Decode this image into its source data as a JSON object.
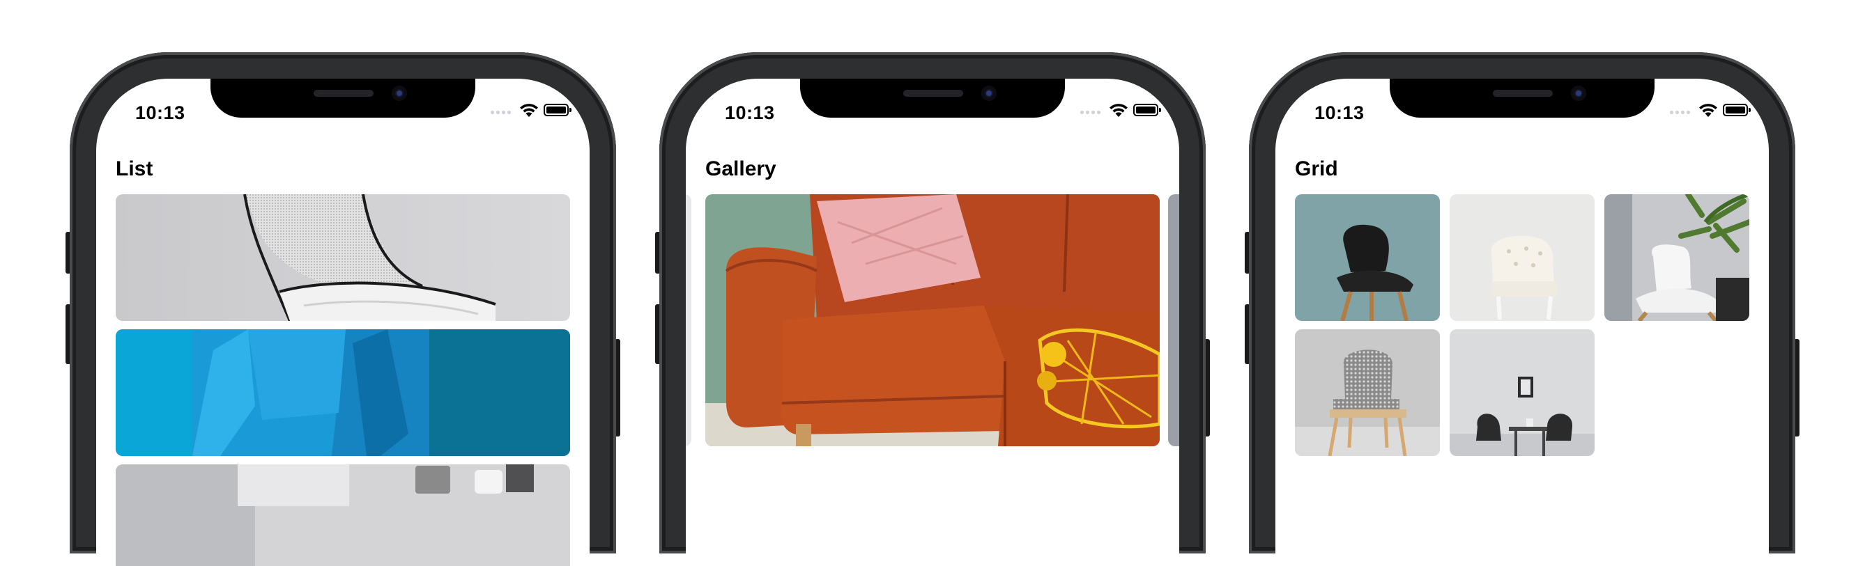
{
  "phones": [
    {
      "time": "10:13",
      "title": "List"
    },
    {
      "time": "10:13",
      "title": "Gallery"
    },
    {
      "time": "10:13",
      "title": "Grid"
    }
  ],
  "status_icons": [
    "signal-dots-icon",
    "wifi-icon",
    "battery-icon"
  ],
  "images": {
    "list": [
      "white-chair-photo",
      "blue-chair-photo",
      "chair-and-kettle-photo"
    ],
    "gallery": [
      "orange-sofa-photo"
    ],
    "grid": [
      "black-chair-photo",
      "tufted-chair-photo",
      "white-chair-plant-photo",
      "patterned-chair-photo",
      "dining-table-photo"
    ]
  }
}
